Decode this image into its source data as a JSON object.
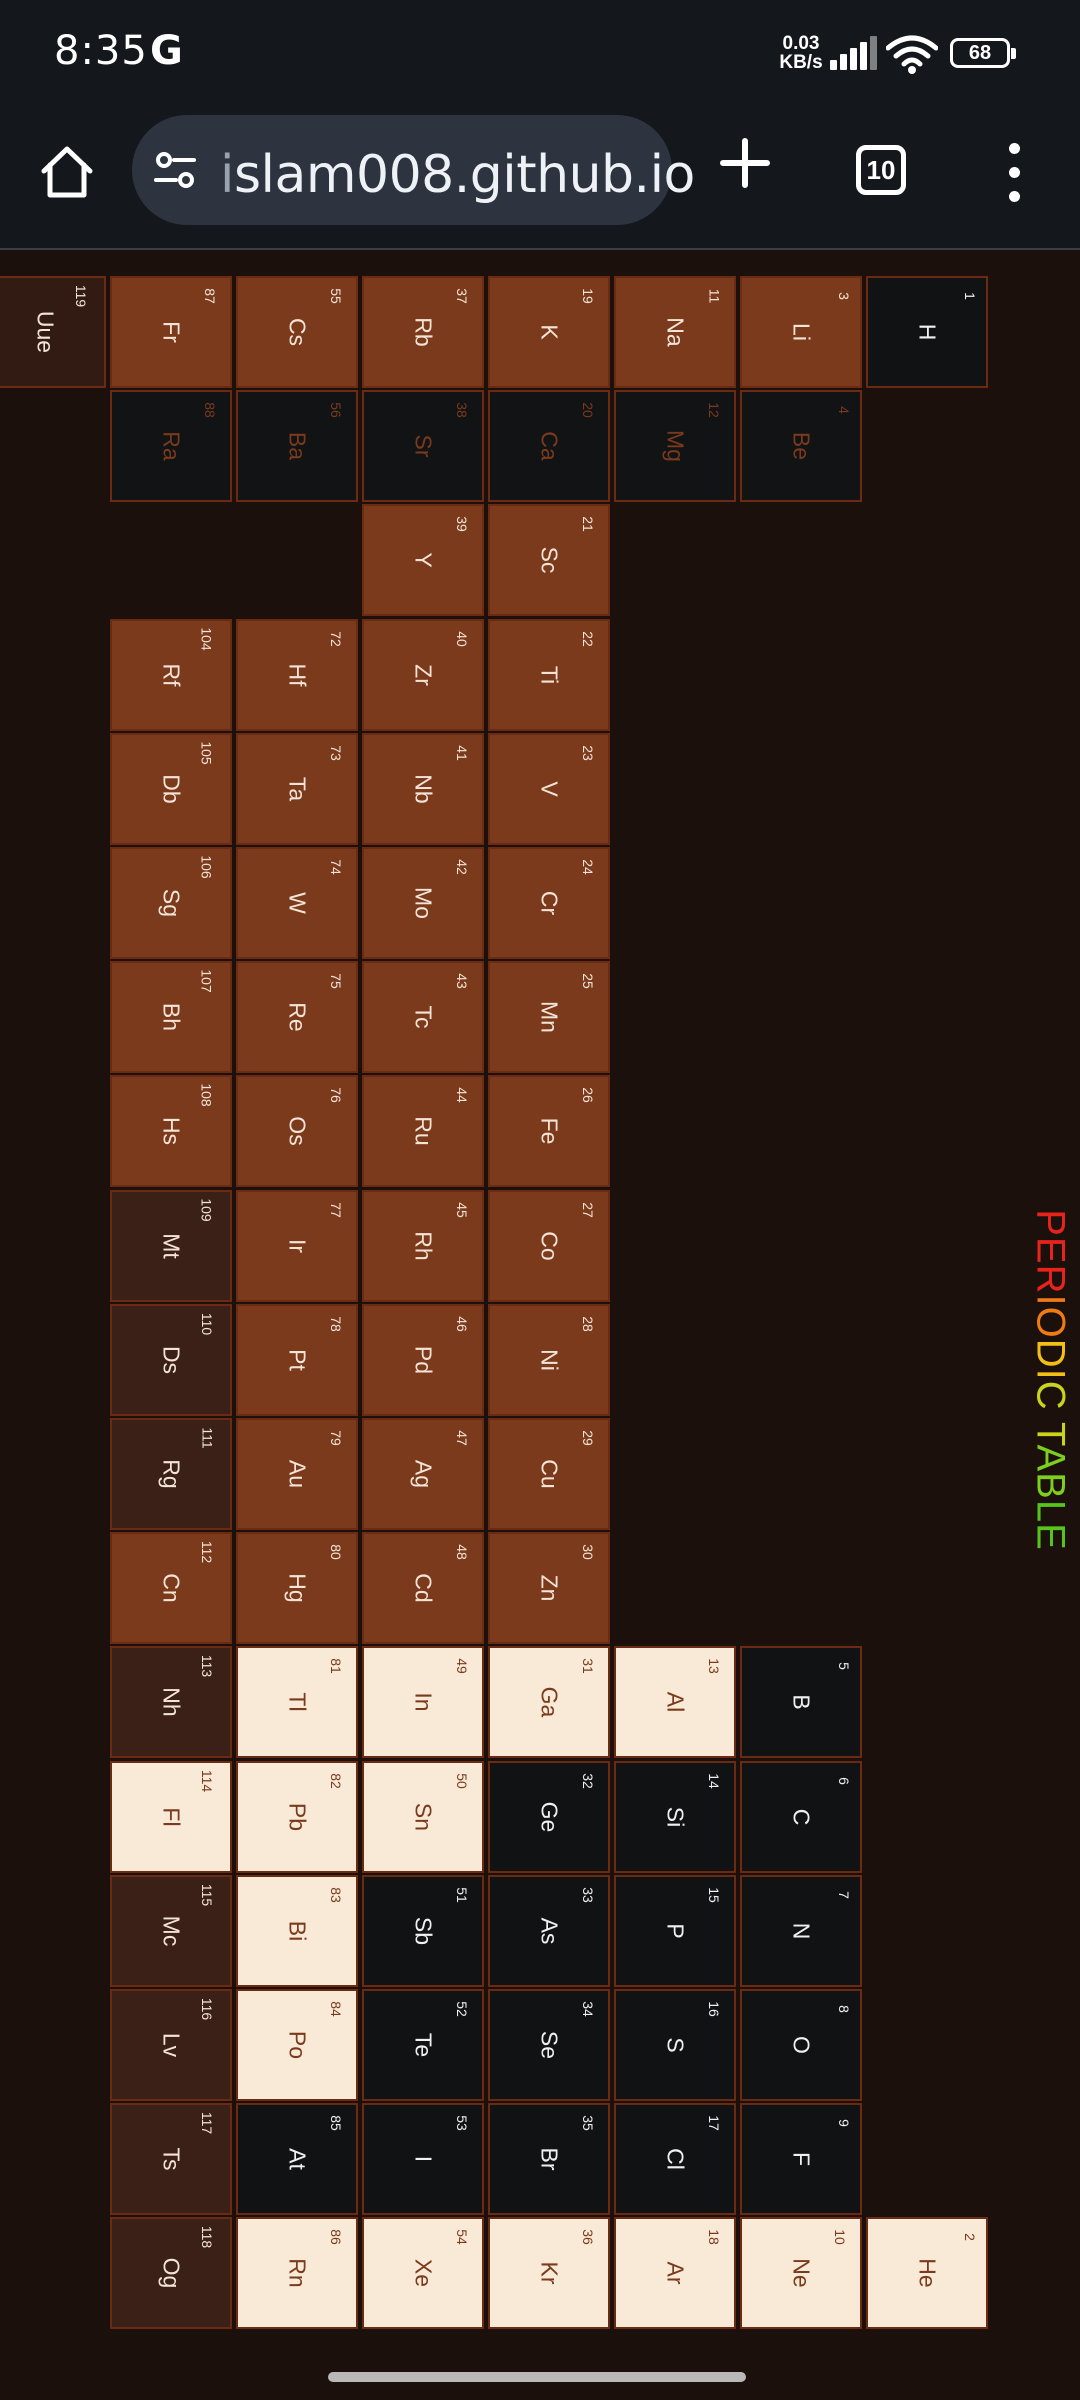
{
  "status_bar": {
    "time": "8:35",
    "carrier_icon": "G",
    "net_speed_value": "0.03",
    "net_speed_unit": "KB/s",
    "battery": "68"
  },
  "browser": {
    "url": "islam008.github.io",
    "tab_count": "10"
  },
  "page": {
    "title_parts": [
      {
        "text": "PERIODIC ",
        "color": "#e8231c"
      },
      {
        "text": "TABLE",
        "color": "#7ccf1d"
      }
    ],
    "title_colors": [
      "#e8231c",
      "#f07a14",
      "#f2c014",
      "#c9d41a",
      "#7ccf1d",
      "#57c41b"
    ]
  },
  "elements": [
    {
      "symbol": "H",
      "number": "1",
      "kind": "dark"
    },
    {
      "symbol": "Li",
      "number": "3",
      "kind": "metal"
    },
    {
      "symbol": "Na",
      "number": "11",
      "kind": "metal"
    },
    {
      "symbol": "K",
      "number": "19",
      "kind": "metal"
    },
    {
      "symbol": "Rb",
      "number": "37",
      "kind": "metal"
    },
    {
      "symbol": "Cs",
      "number": "55",
      "kind": "metal"
    },
    {
      "symbol": "Fr",
      "number": "87",
      "kind": "metal"
    },
    {
      "symbol": "Uue",
      "number": "119",
      "kind": "brown2"
    },
    {
      "symbol": "Be",
      "number": "4",
      "kind": "faded"
    },
    {
      "symbol": "Mg",
      "number": "12",
      "kind": "faded"
    },
    {
      "symbol": "Ca",
      "number": "20",
      "kind": "faded"
    },
    {
      "symbol": "Sr",
      "number": "38",
      "kind": "faded"
    },
    {
      "symbol": "Ba",
      "number": "56",
      "kind": "faded"
    },
    {
      "symbol": "Ra",
      "number": "88",
      "kind": "faded"
    },
    {
      "symbol": "Sc",
      "number": "21",
      "kind": "metal"
    },
    {
      "symbol": "Y",
      "number": "39",
      "kind": "metal"
    },
    {
      "symbol": "Ti",
      "number": "22",
      "kind": "metal"
    },
    {
      "symbol": "Zr",
      "number": "40",
      "kind": "metal"
    },
    {
      "symbol": "Hf",
      "number": "72",
      "kind": "metal"
    },
    {
      "symbol": "Rf",
      "number": "104",
      "kind": "metal"
    },
    {
      "symbol": "V",
      "number": "23",
      "kind": "metal"
    },
    {
      "symbol": "Nb",
      "number": "41",
      "kind": "metal"
    },
    {
      "symbol": "Ta",
      "number": "73",
      "kind": "metal"
    },
    {
      "symbol": "Db",
      "number": "105",
      "kind": "metal"
    },
    {
      "symbol": "Cr",
      "number": "24",
      "kind": "metal"
    },
    {
      "symbol": "Mo",
      "number": "42",
      "kind": "metal"
    },
    {
      "symbol": "W",
      "number": "74",
      "kind": "metal"
    },
    {
      "symbol": "Sg",
      "number": "106",
      "kind": "metal"
    },
    {
      "symbol": "Mn",
      "number": "25",
      "kind": "metal"
    },
    {
      "symbol": "Tc",
      "number": "43",
      "kind": "metal"
    },
    {
      "symbol": "Re",
      "number": "75",
      "kind": "metal"
    },
    {
      "symbol": "Bh",
      "number": "107",
      "kind": "metal"
    },
    {
      "symbol": "Fe",
      "number": "26",
      "kind": "metal"
    },
    {
      "symbol": "Ru",
      "number": "44",
      "kind": "metal"
    },
    {
      "symbol": "Os",
      "number": "76",
      "kind": "metal"
    },
    {
      "symbol": "Hs",
      "number": "108",
      "kind": "metal"
    },
    {
      "symbol": "Co",
      "number": "27",
      "kind": "metal"
    },
    {
      "symbol": "Rh",
      "number": "45",
      "kind": "metal"
    },
    {
      "symbol": "Ir",
      "number": "77",
      "kind": "metal"
    },
    {
      "symbol": "Mt",
      "number": "109",
      "kind": "brown"
    },
    {
      "symbol": "Ni",
      "number": "28",
      "kind": "metal"
    },
    {
      "symbol": "Pd",
      "number": "46",
      "kind": "metal"
    },
    {
      "symbol": "Pt",
      "number": "78",
      "kind": "metal"
    },
    {
      "symbol": "Ds",
      "number": "110",
      "kind": "brown"
    },
    {
      "symbol": "Cu",
      "number": "29",
      "kind": "metal"
    },
    {
      "symbol": "Ag",
      "number": "47",
      "kind": "metal"
    },
    {
      "symbol": "Au",
      "number": "79",
      "kind": "metal"
    },
    {
      "symbol": "Rg",
      "number": "111",
      "kind": "brown"
    },
    {
      "symbol": "Zn",
      "number": "30",
      "kind": "metal"
    },
    {
      "symbol": "Cd",
      "number": "48",
      "kind": "metal"
    },
    {
      "symbol": "Hg",
      "number": "80",
      "kind": "metal"
    },
    {
      "symbol": "Cn",
      "number": "112",
      "kind": "metal"
    },
    {
      "symbol": "B",
      "number": "5",
      "kind": "dark"
    },
    {
      "symbol": "Al",
      "number": "13",
      "kind": "light"
    },
    {
      "symbol": "Ga",
      "number": "31",
      "kind": "light"
    },
    {
      "symbol": "In",
      "number": "49",
      "kind": "light"
    },
    {
      "symbol": "Tl",
      "number": "81",
      "kind": "light"
    },
    {
      "symbol": "Nh",
      "number": "113",
      "kind": "brown"
    },
    {
      "symbol": "C",
      "number": "6",
      "kind": "dark"
    },
    {
      "symbol": "Si",
      "number": "14",
      "kind": "dark"
    },
    {
      "symbol": "Ge",
      "number": "32",
      "kind": "dark"
    },
    {
      "symbol": "Sn",
      "number": "50",
      "kind": "light"
    },
    {
      "symbol": "Pb",
      "number": "82",
      "kind": "light"
    },
    {
      "symbol": "Fl",
      "number": "114",
      "kind": "light"
    },
    {
      "symbol": "N",
      "number": "7",
      "kind": "dark"
    },
    {
      "symbol": "P",
      "number": "15",
      "kind": "dark"
    },
    {
      "symbol": "As",
      "number": "33",
      "kind": "dark"
    },
    {
      "symbol": "Sb",
      "number": "51",
      "kind": "dark"
    },
    {
      "symbol": "Bi",
      "number": "83",
      "kind": "light"
    },
    {
      "symbol": "Mc",
      "number": "115",
      "kind": "brown"
    },
    {
      "symbol": "O",
      "number": "8",
      "kind": "dark"
    },
    {
      "symbol": "S",
      "number": "16",
      "kind": "dark"
    },
    {
      "symbol": "Se",
      "number": "34",
      "kind": "dark"
    },
    {
      "symbol": "Te",
      "number": "52",
      "kind": "dark"
    },
    {
      "symbol": "Po",
      "number": "84",
      "kind": "light"
    },
    {
      "symbol": "Lv",
      "number": "116",
      "kind": "brown"
    },
    {
      "symbol": "F",
      "number": "9",
      "kind": "dark"
    },
    {
      "symbol": "Cl",
      "number": "17",
      "kind": "dark"
    },
    {
      "symbol": "Br",
      "number": "35",
      "kind": "dark"
    },
    {
      "symbol": "I",
      "number": "53",
      "kind": "dark"
    },
    {
      "symbol": "At",
      "number": "85",
      "kind": "dark"
    },
    {
      "symbol": "Ts",
      "number": "117",
      "kind": "brown"
    },
    {
      "symbol": "He",
      "number": "2",
      "kind": "light"
    },
    {
      "symbol": "Ne",
      "number": "10",
      "kind": "light"
    },
    {
      "symbol": "Ar",
      "number": "18",
      "kind": "light"
    },
    {
      "symbol": "Kr",
      "number": "36",
      "kind": "light"
    },
    {
      "symbol": "Xe",
      "number": "54",
      "kind": "light"
    },
    {
      "symbol": "Rn",
      "number": "86",
      "kind": "light"
    },
    {
      "symbol": "Og",
      "number": "118",
      "kind": "brown"
    }
  ]
}
